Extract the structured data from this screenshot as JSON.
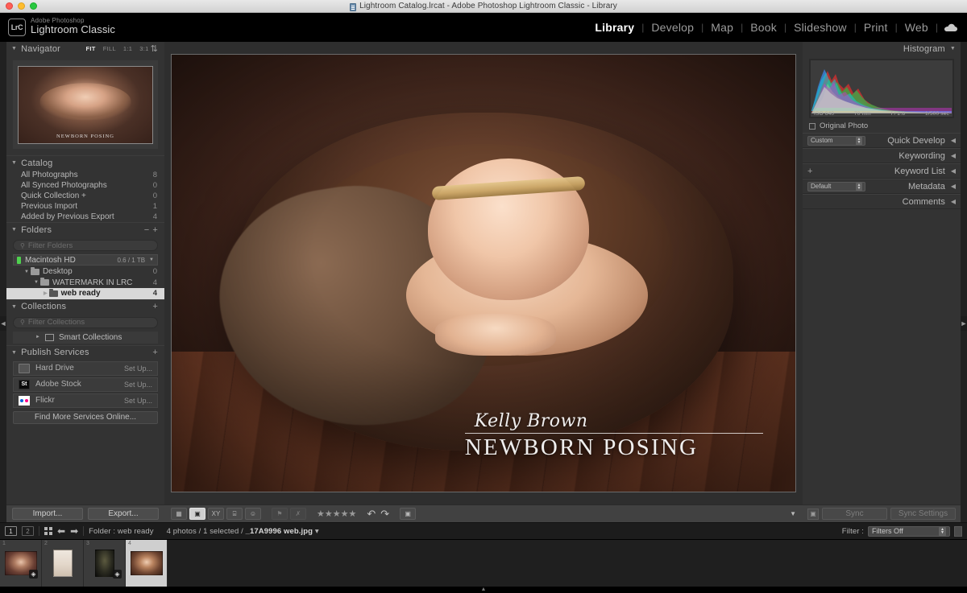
{
  "window": {
    "title": "Lightroom Catalog.lrcat - Adobe Photoshop Lightroom Classic - Library",
    "traffic_icon": "window-controls"
  },
  "identity": {
    "logo_text": "LrC",
    "brand_sub": "Adobe Photoshop",
    "brand_main": "Lightroom Classic"
  },
  "modules": [
    {
      "label": "Library",
      "active": true
    },
    {
      "label": "Develop",
      "active": false
    },
    {
      "label": "Map",
      "active": false
    },
    {
      "label": "Book",
      "active": false
    },
    {
      "label": "Slideshow",
      "active": false
    },
    {
      "label": "Print",
      "active": false
    },
    {
      "label": "Web",
      "active": false
    }
  ],
  "module_separator": "|",
  "cloud_icon": "cloud-sync-icon",
  "navigator": {
    "title": "Navigator",
    "modes": [
      "FIT",
      "FILL",
      "1:1",
      "3:1"
    ],
    "active_mode": "FIT",
    "preview_watermark": "NEWBORN POSING"
  },
  "catalog": {
    "title": "Catalog",
    "items": [
      {
        "label": "All Photographs",
        "count": "8"
      },
      {
        "label": "All Synced Photographs",
        "count": "0"
      },
      {
        "label": "Quick Collection  +",
        "count": "0"
      },
      {
        "label": "Previous Import",
        "count": "1"
      },
      {
        "label": "Added by Previous Export",
        "count": "4"
      }
    ]
  },
  "folders": {
    "title": "Folders",
    "filter_placeholder": "Filter Folders",
    "volume": {
      "name": "Macintosh HD",
      "capacity": "0.6 / 1 TB"
    },
    "items": [
      {
        "label": "Desktop",
        "count": "0",
        "indent": 1,
        "selected": false,
        "twisty": "▼"
      },
      {
        "label": "WATERMARK IN LRC",
        "count": "4",
        "indent": 2,
        "selected": false,
        "twisty": "▼"
      },
      {
        "label": "web ready",
        "count": "4",
        "indent": 3,
        "selected": true,
        "twisty": "▶"
      }
    ]
  },
  "collections": {
    "title": "Collections",
    "filter_placeholder": "Filter Collections",
    "items": [
      {
        "label": "Smart Collections"
      }
    ]
  },
  "publish": {
    "title": "Publish Services",
    "services": [
      {
        "label": "Hard Drive",
        "action": "Set Up...",
        "icon": "hard-drive-icon"
      },
      {
        "label": "Adobe Stock",
        "action": "Set Up...",
        "icon": "adobe-stock-icon",
        "mark": "St"
      },
      {
        "label": "Flickr",
        "action": "Set Up...",
        "icon": "flickr-icon"
      }
    ],
    "find_more": "Find More Services Online..."
  },
  "left_buttons": {
    "import": "Import...",
    "export": "Export..."
  },
  "photo": {
    "watermark_script": "Kelly Brown",
    "watermark_title": "NEWBORN POSING"
  },
  "toolbar": {
    "view_buttons": [
      {
        "name": "grid-view",
        "glyph": "▦",
        "active": false
      },
      {
        "name": "loupe-view",
        "glyph": "▣",
        "active": true
      },
      {
        "name": "compare-view",
        "glyph": "XY",
        "active": false
      },
      {
        "name": "survey-view",
        "glyph": "⌸",
        "active": false
      },
      {
        "name": "people-view",
        "glyph": "☺",
        "active": false
      }
    ],
    "flag_buttons": [
      {
        "name": "flag-pick",
        "glyph": "⚑"
      },
      {
        "name": "flag-reject",
        "glyph": "✗"
      }
    ],
    "stars": "★★★★★",
    "rotate_left": "↶",
    "rotate_right": "↷",
    "crop_tool": "▣",
    "collapse_chevron": "▼"
  },
  "histogram": {
    "title": "Histogram",
    "iso": "ISO 640",
    "focal": "70 mm",
    "aperture": "f / 2.8",
    "shutter": "1/500 sec",
    "original_photo": "Original Photo"
  },
  "right_sections": [
    {
      "label": "Quick Develop",
      "preset": "Custom",
      "arrow": "◀",
      "has_select": true,
      "has_plus": false
    },
    {
      "label": "Keywording",
      "arrow": "◀",
      "has_select": false,
      "has_plus": false
    },
    {
      "label": "Keyword List",
      "arrow": "◀",
      "has_select": false,
      "has_plus": true
    },
    {
      "label": "Metadata",
      "preset": "Default",
      "arrow": "◀",
      "has_select": true,
      "has_plus": false
    },
    {
      "label": "Comments",
      "arrow": "◀",
      "has_select": false,
      "has_plus": false
    }
  ],
  "sync": {
    "sync": "Sync",
    "sync_settings": "Sync Settings"
  },
  "filmstrip_bar": {
    "screen1": "1",
    "screen2": "2",
    "folder_label": "Folder : web ready",
    "status": "4 photos / 1 selected / ",
    "filename": "_17A9996 web.jpg",
    "filename_caret": "▾",
    "filter_label": "Filter :",
    "filter_value": "Filters Off"
  },
  "filmstrip": {
    "thumbs": [
      {
        "num": "1",
        "selected": false,
        "badge": "◈"
      },
      {
        "num": "2",
        "selected": false,
        "badge": ""
      },
      {
        "num": "3",
        "selected": false,
        "badge": "◈"
      },
      {
        "num": "4",
        "selected": true,
        "badge": ""
      }
    ]
  },
  "colors": {
    "panel_bg": "#333333",
    "workspace_bg": "#2b2b2b",
    "accent_selected": "#d8d8d8",
    "text_primary": "#b8b8b8"
  }
}
